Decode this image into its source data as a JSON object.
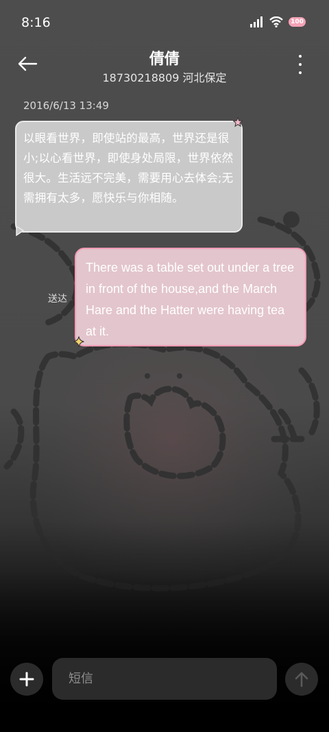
{
  "status_bar": {
    "time": "8:16",
    "battery_label": "100",
    "icons": [
      "signal-icon",
      "wifi-icon",
      "battery-icon"
    ]
  },
  "header": {
    "contact_name": "倩倩",
    "contact_subtitle": "18730218809 河北保定",
    "icons": [
      "back-arrow-icon",
      "more-vertical-icon"
    ]
  },
  "conversation": {
    "timestamp": "2016/6/13 13:49",
    "received_message": "以眼看世界，即使站的最高，世界还是很小;以心看世界，即使身处局限，世界依然很大。生活远不完美，需要用心去体会;无需拥有太多，愿快乐与你相随。",
    "sent_status": "送达",
    "sent_message": "There was a table set out under a tree in front of the house,and the March Hare and the Hatter were having tea at it."
  },
  "composer": {
    "placeholder": "短信",
    "icons": [
      "plus-icon",
      "send-arrow-icon"
    ]
  },
  "colors": {
    "received_bubble": "#c9c9c9",
    "sent_bubble": "#e3c5cd",
    "sent_bubble_border": "#f39ab4",
    "battery": "#f4a2b6",
    "input_background": "#2b2b2b"
  }
}
